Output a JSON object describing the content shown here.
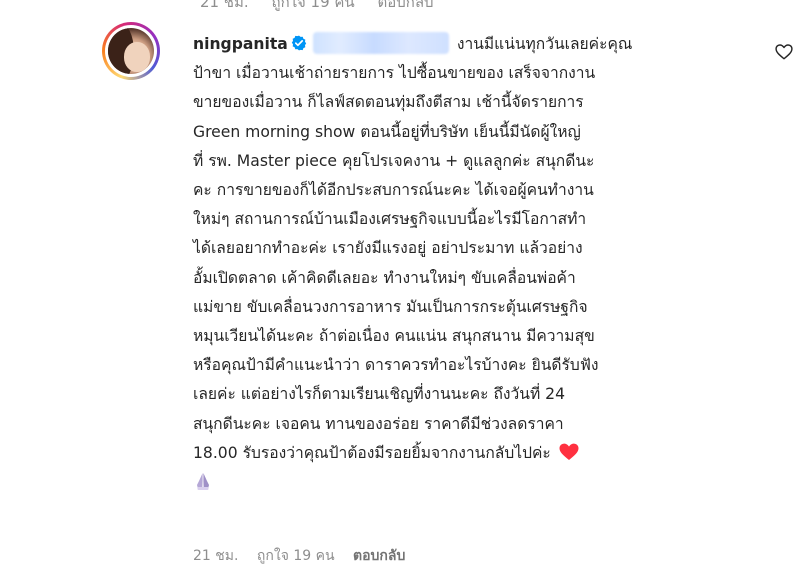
{
  "top_meta": {
    "time": "21 ชม.",
    "likes": "ถูกใจ 19 คน",
    "reply": "ตอบกลับ"
  },
  "comment": {
    "username": "ningpanita",
    "verified_icon": "verified-badge-icon",
    "mention_blurred": true,
    "lines": [
      "งานมีแน่นทุกวันเลยค่ะคุณ",
      "ป้าขา เมื่อวานเช้าถ่ายรายการ ไปซื้อนขายของ เสร็จจากงาน",
      "ขายของเมื่อวาน ก็ไลฟ์สดตอนทุ่มถึงตีสาม เช้านี้จัดรายการ",
      "Green morning show ตอนนี้อยู่ที่บริษัท เย็นนี้มีนัดผู้ใหญ่",
      "ที่ รพ. Master piece คุยโปรเจคงาน + ดูแลลูกค่ะ สนุกดีนะ",
      "คะ การขายของก็ได้อีกประสบการณ์นะคะ ได้เจอผู้คนทำงาน",
      "ใหม่ๆ สถานการณ์บ้านเมืองเศรษฐกิจแบบนี้อะไรมีโอกาสทำ",
      "ได้เลยอยากทำอะค่ะ เรายังมีแรงอยู่ อย่าประมาท แล้วอย่าง",
      "อั้มเปิดตลาด เค้าคิดดีเลยอะ ทำงานใหม่ๆ ขับเคลื่อนพ่อค้า",
      "แม่ขาย ขับเคลื่อนวงการอาหาร มันเป็นการกระตุ้นเศรษฐกิจ",
      "หมุนเวียนได้นะคะ ถ้าต่อเนื่อง คนแน่น สนุกสนาน มีความสุข",
      "หรือคุณป้ามีคำแนะนำว่า ดาราควรทำอะไรบ้างคะ ยินดีรับฟัง",
      "เลยค่ะ แต่อย่างไรก็ตามเรียนเชิญที่งานนะคะ ถึงวันที่ 24",
      "สนุกดีนะคะ เจอคน ทานของอร่อย ราคาดีมีช่วงลดราคา",
      "18.00 รับรองว่าคุณป้าต้องมีรอยยิ้มจากงานกลับไปค่ะ"
    ],
    "emojis": [
      "heart-emoji",
      "folded-hands-emoji"
    ]
  },
  "footer": {
    "time": "21 ชม.",
    "likes": "ถูกใจ 19 คน",
    "reply": "ตอบกลับ"
  },
  "colors": {
    "text": "#262626",
    "muted": "#8e8e8e",
    "verified": "#0095f6",
    "heart": "#ff3040"
  }
}
